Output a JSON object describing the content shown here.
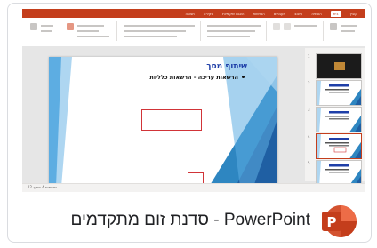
{
  "caption": {
    "text": "PowerPoint - סדנת זום מתקדמים"
  },
  "app_icon": {
    "name": "powerpoint-icon",
    "letter": "P",
    "colors": {
      "light": "#ed6c47",
      "mid": "#d35230",
      "dark": "#c43e1c",
      "tile": "#c43e1c"
    }
  },
  "ribbon": {
    "tabs": [
      "קובץ",
      "בית",
      "הוספה",
      "עיצוב",
      "מעברים",
      "הנפשות",
      "הצגת שקופיות",
      "סקירה",
      "תצוגה"
    ],
    "active_tab_index": 1,
    "accent": "#c43e1c"
  },
  "slide": {
    "title": "שיתוף מסך",
    "bullet": "הרשאות עריכה - הרשאות כלליות",
    "title_color": "#1f3fa8",
    "accent_blues": [
      "#1f5fa3",
      "#2e86c1",
      "#5dade2",
      "#aed6f1"
    ],
    "selection_color": "#d13438"
  },
  "thumbnails": [
    {
      "num": "1",
      "dark": true
    },
    {
      "num": "2",
      "dark": false
    },
    {
      "num": "3",
      "dark": false
    },
    {
      "num": "4",
      "dark": false,
      "active": true
    },
    {
      "num": "5",
      "dark": false
    }
  ],
  "status": {
    "text": "שקופית 4 מתוך 12"
  }
}
